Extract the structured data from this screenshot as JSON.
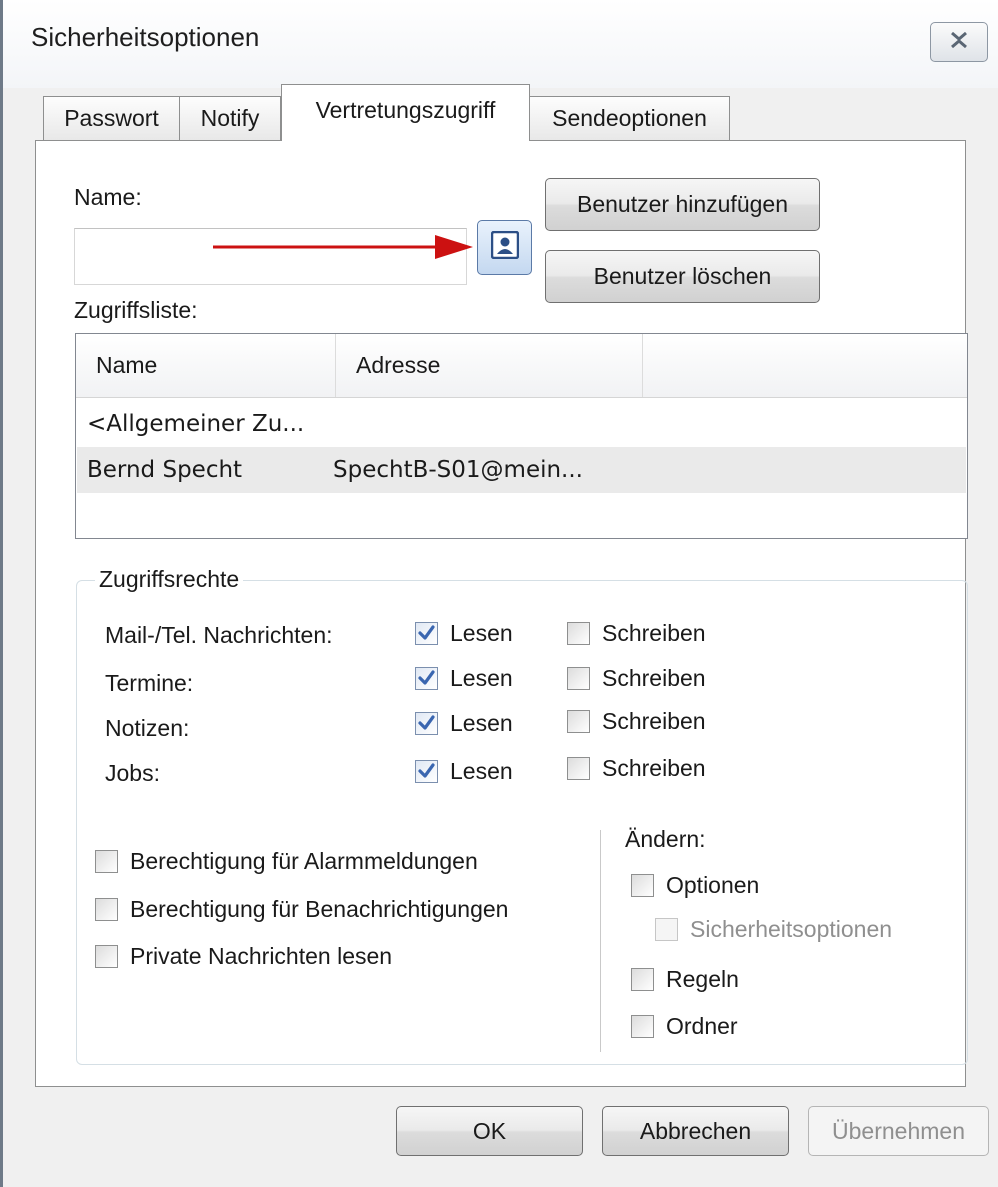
{
  "window": {
    "title": "Sicherheitsoptionen"
  },
  "tabs": [
    "Passwort",
    "Notify",
    "Vertretungszugriff",
    "Sendeoptionen"
  ],
  "active_tab": "Vertretungszugriff",
  "name_section": {
    "label": "Name:",
    "value": "",
    "add_user": "Benutzer hinzufügen",
    "delete_user": "Benutzer löschen"
  },
  "access_list": {
    "label": "Zugriffsliste:",
    "columns": [
      "Name",
      "Adresse"
    ],
    "rows": [
      {
        "name": "<Allgemeiner Zu...",
        "address": ""
      },
      {
        "name": "Bernd Specht",
        "address": "SpechtB-S01@mein..."
      }
    ]
  },
  "rights": {
    "legend": "Zugriffsrechte",
    "items": [
      {
        "label": "Mail-/Tel. Nachrichten:",
        "read_label": "Lesen",
        "read": true,
        "write_label": "Schreiben",
        "write": false
      },
      {
        "label": "Termine:",
        "read_label": "Lesen",
        "read": true,
        "write_label": "Schreiben",
        "write": false
      },
      {
        "label": "Notizen:",
        "read_label": "Lesen",
        "read": true,
        "write_label": "Schreiben",
        "write": false
      },
      {
        "label": "Jobs:",
        "read_label": "Lesen",
        "read": true,
        "write_label": "Schreiben",
        "write": false
      }
    ],
    "permissions": [
      {
        "label": "Berechtigung für Alarmmeldungen",
        "checked": false
      },
      {
        "label": "Berechtigung für Benachrichtigungen",
        "checked": false
      },
      {
        "label": "Private Nachrichten lesen",
        "checked": false
      }
    ],
    "change": {
      "label": "Ändern:",
      "options": "Optionen",
      "security_options": "Sicherheitsoptionen",
      "rules": "Regeln",
      "folders": "Ordner"
    }
  },
  "footer": {
    "ok": "OK",
    "cancel": "Abbrechen",
    "apply": "Übernehmen"
  },
  "colors": {
    "annotation_arrow": "#cc1111",
    "check": "#3a66b0"
  }
}
